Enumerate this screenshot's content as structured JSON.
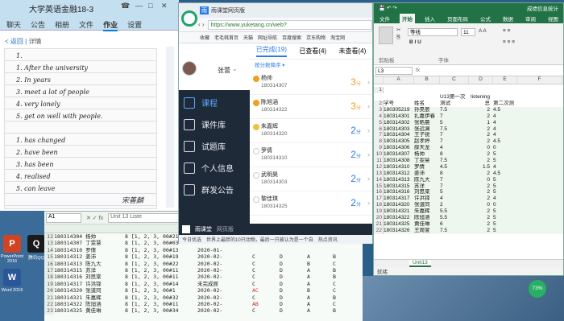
{
  "qq": {
    "title": "大学英语金融18-3",
    "tabs": [
      "聊天",
      "公告",
      "相册",
      "文件",
      "作业",
      "设置"
    ],
    "active_tab": "作业",
    "back": "< 返回",
    "detail": "详情",
    "hw_lines": [
      "1.",
      "1. After the university",
      "2. In years",
      "3. meet a lot of people",
      "4. very lonely",
      "5. get on well with people.",
      "",
      "1. has changed",
      "2. have been",
      "3. has been",
      "4. realised",
      "5. can leave"
    ],
    "signature": "宋善麟"
  },
  "desktop": {
    "icons": [
      {
        "name": "ppt-icon",
        "letter": "P",
        "color": "#d04423",
        "label": "PowerPoint 2016"
      },
      {
        "name": "word-icon",
        "letter": "W",
        "color": "#2b579a",
        "label": "Word 2016"
      },
      {
        "name": "qq-icon",
        "letter": "Q",
        "color": "#1a1a1a",
        "label": "腾讯QQ"
      }
    ]
  },
  "sheet2": {
    "namebox": "A1",
    "formula": "Unit 13 Liste",
    "rows": [
      {
        "n": "12",
        "c1": "180314304 杨帅",
        "c2": "8 [1, 2, 3, 00#21",
        "c3": "",
        "c4": "",
        "c5": "",
        "c6": "",
        "c7": ""
      },
      {
        "n": "13",
        "c1": "180314307 丁雯慧",
        "c2": "8 [1, 2, 3, 00#03",
        "c3": "",
        "c4": "",
        "c5": "",
        "c6": "",
        "c7": ""
      },
      {
        "n": "14",
        "c1": "180314310 罗倩",
        "c2": "8 [1, 2, 3, 00#13",
        "c3": "2020-01-",
        "c4": "",
        "c5": "",
        "c6": "",
        "c7": ""
      },
      {
        "n": "15",
        "c1": "180314312 姜沛",
        "c2": "8 [1, 2, 3, 00#19",
        "c3": "2020-02-",
        "c4": "C",
        "c5": "D",
        "c6": "A",
        "c7": "B"
      },
      {
        "n": "16",
        "c1": "180314313 陈九大",
        "c2": "8 [1, 2, 3, 00#22",
        "c3": "2020-02-",
        "c4": "C",
        "c5": "D",
        "c6": "B",
        "c7": "C"
      },
      {
        "n": "17",
        "c1": "180314315 苏洋",
        "c2": "8 [1, 2, 3, 00#11",
        "c3": "2020-02-",
        "c4": "C",
        "c5": "D",
        "c6": "A",
        "c7": "B"
      },
      {
        "n": "18",
        "c1": "180314316 刘思棠",
        "c2": "8 [1, 2, 3, 00#11",
        "c3": "2020-02-",
        "c4": "C",
        "c5": "D",
        "c6": "A",
        "c7": "B"
      },
      {
        "n": "19",
        "c1": "180314317 许洪铎",
        "c2": "8 [1, 2, 3, 00#14",
        "c3": "未完成原",
        "c4": "C",
        "c5": "D",
        "c6": "A",
        "c7": "C"
      },
      {
        "n": "20",
        "c1": "180314320 张道同",
        "c2": "8 [1, 2, 3, 00#1",
        "c3": "2020-02-",
        "c4": "AC",
        "c5": "D",
        "c6": "B",
        "c7": "C"
      },
      {
        "n": "21",
        "c1": "180314321 朱嘉辉",
        "c2": "8 [1, 2, 3, 00#32",
        "c3": "2020-02-",
        "c4": "C",
        "c5": "D",
        "c6": "A",
        "c7": "B"
      },
      {
        "n": "22",
        "c1": "180314322 陈旭涵",
        "c2": "8 [1, 2, 3, 00#11",
        "c3": "2020-02-",
        "c4": "AB",
        "c5": "D",
        "c6": "A",
        "c7": "C"
      },
      {
        "n": "23",
        "c1": "180314325 黄佳琳",
        "c2": "8 [1, 2, 3, 00#34",
        "c3": "2020-02-",
        "c4": "C",
        "c5": "D",
        "c6": "A",
        "c7": "B"
      }
    ]
  },
  "yk": {
    "tab_title": "雨课堂网页版",
    "url": "https://www.yuketang.cn/web?",
    "bookmarks": [
      "收藏",
      "老毛桃首页",
      "天猫",
      "网址导航",
      "百度搜索",
      "京东购物",
      "淘宝网"
    ],
    "username": "张蕾",
    "menu": [
      "课程",
      "课件库",
      "试题库",
      "个人信息",
      "群发公告"
    ],
    "tabs": [
      "已完成(19)",
      "已查看(4)",
      "未查看(4)"
    ],
    "sort": "按分数降序 ▾",
    "students": [
      {
        "name": "杨帅",
        "id": "180314307",
        "score": "3",
        "color": "#f0a020"
      },
      {
        "name": "陈旭涵",
        "id": "180314322",
        "score": "3",
        "color": "#f0a020"
      },
      {
        "name": "朱嘉辉",
        "id": "180314320",
        "score": "2",
        "color": "#f0c040"
      },
      {
        "name": "罗倩",
        "id": "180314310",
        "score": "2",
        "color": "#ffffff"
      },
      {
        "name": "武明昊",
        "id": "180314303",
        "score": "2",
        "color": "#ffffff"
      },
      {
        "name": "黎佳琪",
        "id": "180314325",
        "score": "2",
        "color": "#ffffff"
      }
    ],
    "score_unit": "分",
    "taskbar_label": "雨课堂",
    "taskbar_web": "网页版",
    "status_items": [
      "今日优选",
      "世界上最胖的10只动物，最后一只被认为是一个自",
      "热点资讯"
    ]
  },
  "excel": {
    "title_right": "成绩信息统计",
    "tabs": [
      "文件",
      "开始",
      "插入",
      "页面布局",
      "公式",
      "数据",
      "审阅",
      "视图"
    ],
    "active_tab": "开始",
    "font": "等线",
    "size": "11",
    "clipboard_label": "剪贴板",
    "font_label": "字体",
    "namebox": "L3",
    "columns": [
      "A",
      "B",
      "C",
      "D",
      "E",
      "F"
    ],
    "rows": [
      {
        "n": "1",
        "a": "",
        "b": "",
        "c": "",
        "d": "",
        "e": "",
        "f": ""
      },
      {
        "n": "2",
        "a": "学号",
        "b": "姓名",
        "c": "U13第一次测试",
        "d": "listening总",
        "e": "第二次测",
        "f": ""
      },
      {
        "n": "3",
        "a": "180305219",
        "b": "孙昊辰",
        "c": "7.5",
        "d": "2",
        "e": "4.5",
        "f": ""
      },
      {
        "n": "4",
        "a": "180314301",
        "b": "扎嘉伊春",
        "c": "7",
        "d": "2",
        "e": "4",
        "f": ""
      },
      {
        "n": "5",
        "a": "180314302",
        "b": "张皓晨",
        "c": "5",
        "d": "1",
        "e": "4",
        "f": ""
      },
      {
        "n": "6",
        "a": "180314303",
        "b": "张远渊",
        "c": "7.5",
        "d": "2",
        "e": "4",
        "f": ""
      },
      {
        "n": "7",
        "a": "180314304",
        "b": "王子锐",
        "c": "7",
        "d": "2",
        "e": "4",
        "f": ""
      },
      {
        "n": "8",
        "a": "180314305",
        "b": "赵孝婷",
        "c": "7",
        "d": "2",
        "e": "4.5",
        "f": ""
      },
      {
        "n": "9",
        "a": "180314306",
        "b": "薛天龙",
        "c": "4",
        "d": "0",
        "e": "0",
        "f": ""
      },
      {
        "n": "10",
        "a": "180314307",
        "b": "杨帅",
        "c": "8",
        "d": "2",
        "e": "5",
        "f": ""
      },
      {
        "n": "11",
        "a": "180314308",
        "b": "丁雯慧",
        "c": "7.5",
        "d": "2",
        "e": "5",
        "f": ""
      },
      {
        "n": "12",
        "a": "180314310",
        "b": "罗倩",
        "c": "4.5",
        "d": "1.5",
        "e": "4",
        "f": ""
      },
      {
        "n": "13",
        "a": "180314312",
        "b": "姜沛",
        "c": "8",
        "d": "2",
        "e": "4.5",
        "f": ""
      },
      {
        "n": "14",
        "a": "180314313",
        "b": "陈九大",
        "c": "7",
        "d": "0",
        "e": "5",
        "f": ""
      },
      {
        "n": "15",
        "a": "180314315",
        "b": "苏洋",
        "c": "7",
        "d": "2",
        "e": "5",
        "f": ""
      },
      {
        "n": "16",
        "a": "180314316",
        "b": "刘思棠",
        "c": "5",
        "d": "2",
        "e": "5",
        "f": ""
      },
      {
        "n": "17",
        "a": "180314317",
        "b": "许洪铎",
        "c": "4",
        "d": "2",
        "e": "4",
        "f": ""
      },
      {
        "n": "18",
        "a": "180314320",
        "b": "张道同",
        "c": "2",
        "d": "0",
        "e": "0",
        "f": ""
      },
      {
        "n": "19",
        "a": "180314321",
        "b": "朱嘉辉",
        "c": "5.5",
        "d": "2",
        "e": "5",
        "f": ""
      },
      {
        "n": "20",
        "a": "180314322",
        "b": "陈旭涵",
        "c": "5.5",
        "d": "2",
        "e": "5",
        "f": ""
      },
      {
        "n": "21",
        "a": "180314325",
        "b": "黄佳琳",
        "c": "6",
        "d": "2",
        "e": "5",
        "f": ""
      },
      {
        "n": "22",
        "a": "180314326",
        "b": "王周萱",
        "c": "7.5",
        "d": "2",
        "e": "5",
        "f": ""
      }
    ],
    "sheet": "Unit13",
    "status": "就绪"
  },
  "battery": "73%"
}
